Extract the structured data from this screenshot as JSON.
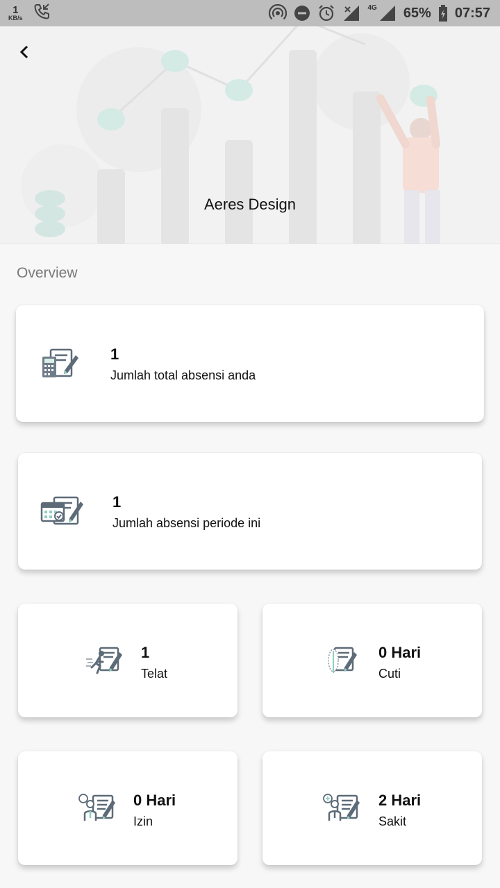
{
  "status_bar": {
    "speed_value": "1",
    "speed_unit": "KB/s",
    "network": "4G",
    "battery": "65%",
    "time": "07:57",
    "icons": [
      "call-icon",
      "hotspot-icon",
      "dnd-icon",
      "alarm-icon",
      "signal-icon",
      "battery-icon"
    ]
  },
  "header": {
    "company_name": "Aeres Design"
  },
  "overview": {
    "title": "Overview",
    "total": {
      "value": "1",
      "label": "Jumlah total absensi anda",
      "icon": "calculator-form-icon"
    },
    "period": {
      "value": "1",
      "label": "Jumlah absensi periode ini",
      "icon": "calendar-form-icon"
    },
    "late": {
      "value": "1",
      "label": "Telat",
      "icon": "running-form-icon"
    },
    "leave": {
      "value": "0 Hari",
      "label": "Cuti",
      "icon": "leaf-form-icon"
    },
    "permit": {
      "value": "0 Hari",
      "label": "Izin",
      "icon": "person-chat-form-icon"
    },
    "sick": {
      "value": "2 Hari",
      "label": "Sakit",
      "icon": "person-medical-form-icon"
    }
  }
}
